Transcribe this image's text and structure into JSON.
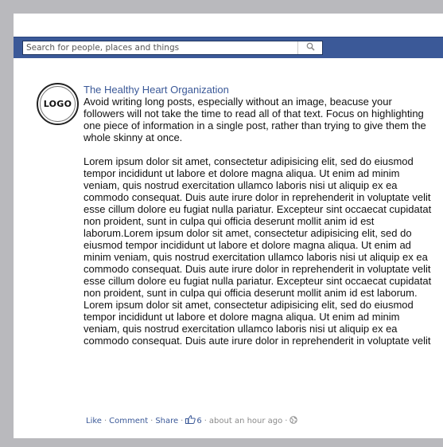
{
  "search": {
    "placeholder": "Search for people, places and things"
  },
  "logo": {
    "text": "LOGO"
  },
  "post": {
    "author": "The Healthy Heart Organization",
    "intro": "Avoid writing long posts, especially without an image, beacuse your followers will not take the time to read all of that text. Focus on highlighting one piece of information in a single post, rather than trying to give them the whole skinny at once.",
    "body": "Lorem ipsum dolor sit amet, consectetur adipisicing elit, sed do eiusmod tempor incididunt ut labore et dolore magna aliqua. Ut enim ad minim veniam, quis nostrud exercitation ullamco laboris nisi ut aliquip ex ea commodo consequat. Duis aute irure dolor in reprehenderit in voluptate velit esse cillum dolore eu fugiat nulla pariatur. Excepteur sint occaecat cupidatat non proident, sunt in culpa qui officia deserunt mollit anim id est laborum.Lorem ipsum dolor sit amet, consectetur adipisicing elit, sed do eiusmod tempor incididunt ut labore et dolore magna aliqua. Ut enim ad minim veniam, quis nostrud exercitation ullamco laboris nisi ut aliquip ex ea commodo consequat. Duis aute irure dolor in reprehenderit in voluptate velit esse cillum dolore eu fugiat nulla pariatur. Excepteur sint occaecat cupidatat non proident, sunt in culpa qui officia deserunt mollit anim id est laborum. Lorem ipsum dolor sit amet, consectetur adipisicing elit, sed do eiusmod tempor incididunt ut labore et dolore magna aliqua. Ut enim ad minim veniam, quis nostrud exercitation ullamco laboris nisi ut aliquip ex ea commodo consequat. Duis aute irure dolor in reprehenderit in voluptate velit"
  },
  "actions": {
    "like": "Like",
    "comment": "Comment",
    "share": "Share",
    "separator": "·",
    "like_count": "6",
    "timestamp": "about an hour ago"
  },
  "icons": {
    "search": "search-icon",
    "thumbs_up": "thumbs-up-icon",
    "audience": "globe-icon"
  },
  "colors": {
    "brand_blue": "#3b5998",
    "page_border": "#b9b9bd",
    "meta_gray": "#8a8a8a"
  }
}
